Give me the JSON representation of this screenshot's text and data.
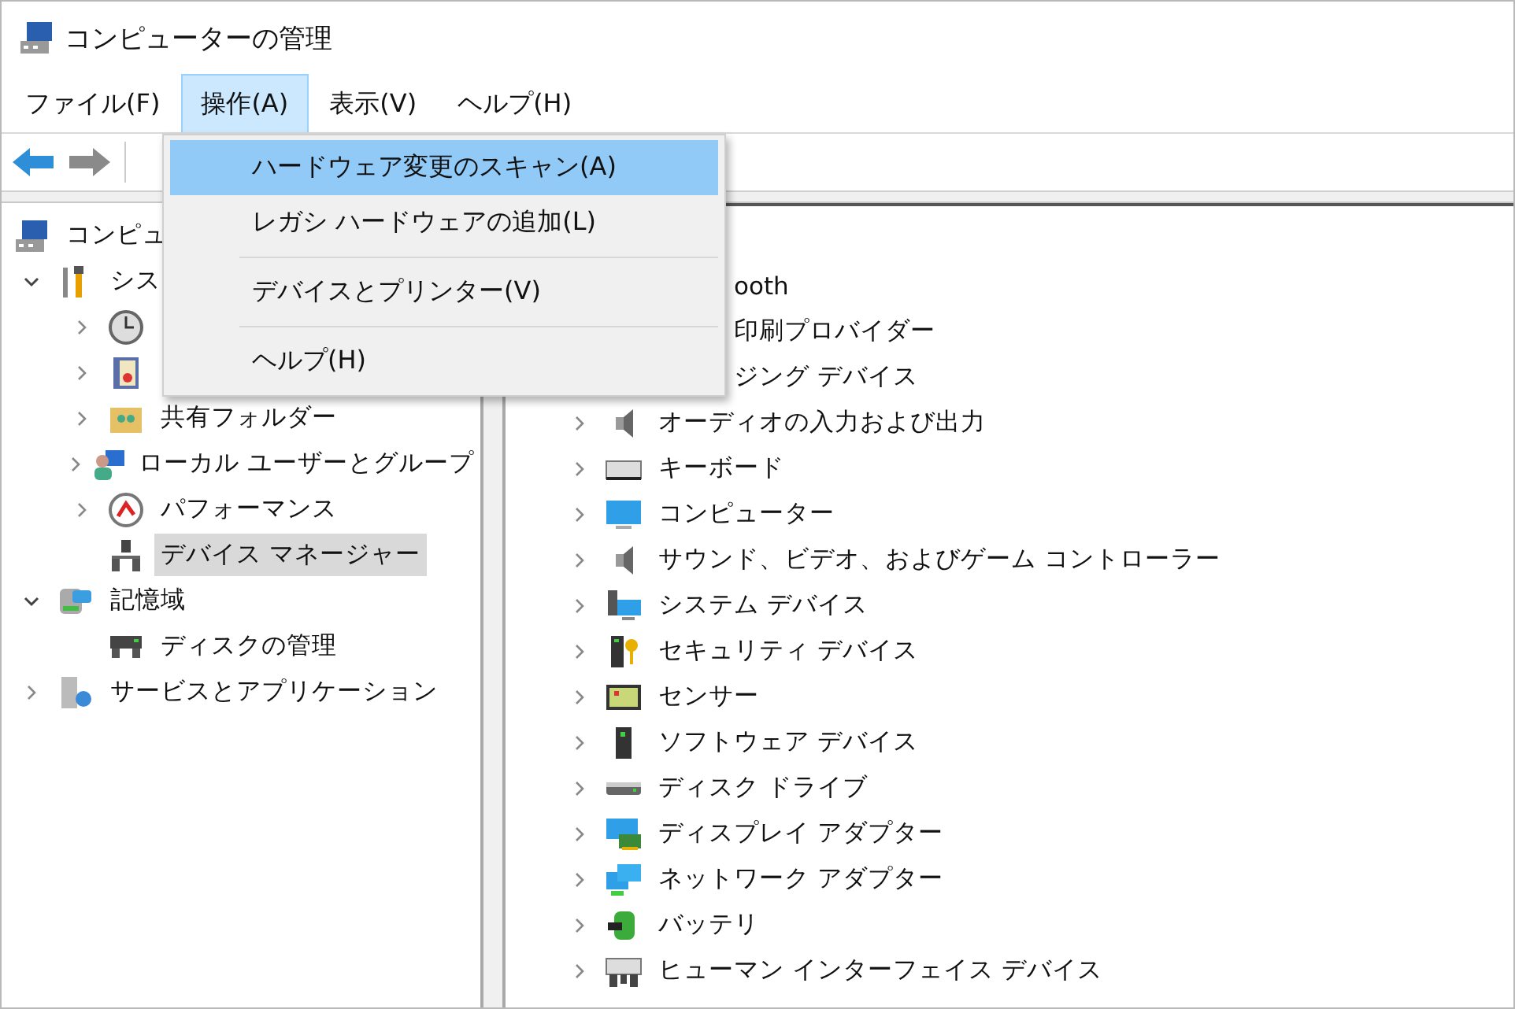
{
  "window": {
    "title": "コンピューターの管理"
  },
  "menubar": [
    {
      "label": "ファイル(F)",
      "selected": false
    },
    {
      "label": "操作(A)",
      "selected": true
    },
    {
      "label": "表示(V)",
      "selected": false
    },
    {
      "label": "ヘルプ(H)",
      "selected": false
    }
  ],
  "menu": {
    "items": [
      {
        "kind": "item",
        "label": "ハードウェア変更のスキャン(A)",
        "selected": true
      },
      {
        "kind": "item",
        "label": "レガシ ハードウェアの追加(L)",
        "selected": false
      },
      {
        "kind": "separator"
      },
      {
        "kind": "item",
        "label": "デバイスとプリンター(V)",
        "selected": false
      },
      {
        "kind": "separator"
      },
      {
        "kind": "item",
        "label": "ヘルプ(H)",
        "selected": false
      }
    ]
  },
  "left_tree": [
    {
      "label": "コンピュ",
      "selected": false,
      "children": [
        {
          "label": "シス",
          "expanded": true,
          "selected": false,
          "children": [
            {
              "expanded": false
            },
            {
              "expanded": false
            },
            {
              "label": "共有フォルダー",
              "expanded": false,
              "selected": false
            },
            {
              "label": "ローカル ユーザーとグループ",
              "expanded": false,
              "selected": false
            },
            {
              "label": "パフォーマンス",
              "expanded": false,
              "selected": false
            },
            {
              "label": "デバイス マネージャー",
              "selected": true
            }
          ]
        },
        {
          "label": "記憶域",
          "expanded": true,
          "selected": false,
          "children": [
            {
              "label": "ディスクの管理",
              "selected": false
            }
          ]
        },
        {
          "label": "サービスとアプリケーション",
          "expanded": false,
          "selected": false
        }
      ]
    }
  ],
  "device_list": [
    {
      "kind": "partial",
      "label": "ooth"
    },
    {
      "kind": "partial",
      "label": "印刷プロバイダー"
    },
    {
      "kind": "partial",
      "label": "ジング デバイス"
    },
    {
      "kind": "full",
      "label": "オーディオの入力および出力",
      "expanded": false
    },
    {
      "kind": "full",
      "label": "キーボード",
      "expanded": false
    },
    {
      "kind": "full",
      "label": "コンピューター",
      "expanded": false
    },
    {
      "kind": "full",
      "label": "サウンド、ビデオ、およびゲーム コントローラー",
      "expanded": false
    },
    {
      "kind": "full",
      "label": "システム デバイス",
      "expanded": false
    },
    {
      "kind": "full",
      "label": "セキュリティ デバイス",
      "expanded": false
    },
    {
      "kind": "full",
      "label": "センサー",
      "expanded": false
    },
    {
      "kind": "full",
      "label": "ソフトウェア デバイス",
      "expanded": false
    },
    {
      "kind": "full",
      "label": "ディスク ドライブ",
      "expanded": false
    },
    {
      "kind": "full",
      "label": "ディスプレイ アダプター",
      "expanded": false
    },
    {
      "kind": "full",
      "label": "ネットワーク アダプター",
      "expanded": false
    },
    {
      "kind": "full",
      "label": "バッテリ",
      "expanded": false
    },
    {
      "kind": "full",
      "label": "ヒューマン インターフェイス デバイス",
      "expanded": false
    }
  ]
}
